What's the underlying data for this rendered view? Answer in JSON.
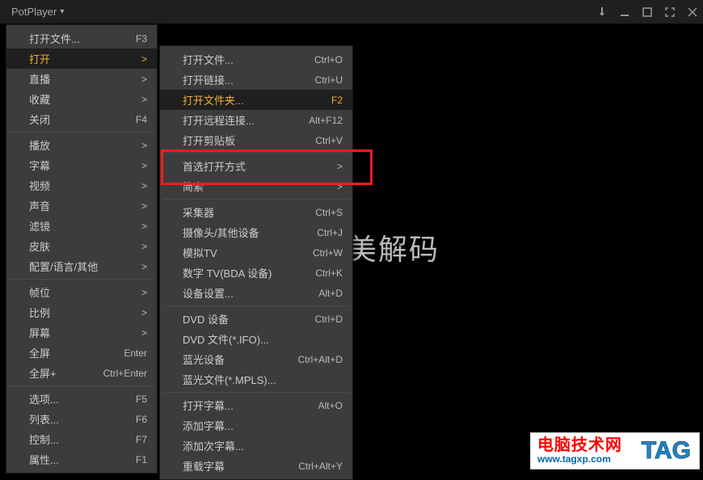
{
  "title": "PotPlayer",
  "watermark": "美解码",
  "menu1": [
    {
      "type": "item",
      "label": "打开文件...",
      "shortcut": "F3"
    },
    {
      "type": "item",
      "label": "打开",
      "shortcut": ">",
      "hl": true
    },
    {
      "type": "item",
      "label": "直播",
      "shortcut": ">"
    },
    {
      "type": "item",
      "label": "收藏",
      "shortcut": ">"
    },
    {
      "type": "item",
      "label": "关闭",
      "shortcut": "F4"
    },
    {
      "type": "sep"
    },
    {
      "type": "item",
      "label": "播放",
      "shortcut": ">"
    },
    {
      "type": "item",
      "label": "字幕",
      "shortcut": ">"
    },
    {
      "type": "item",
      "label": "视频",
      "shortcut": ">"
    },
    {
      "type": "item",
      "label": "声音",
      "shortcut": ">"
    },
    {
      "type": "item",
      "label": "滤镜",
      "shortcut": ">"
    },
    {
      "type": "item",
      "label": "皮肤",
      "shortcut": ">"
    },
    {
      "type": "item",
      "label": "配置/语言/其他",
      "shortcut": ">"
    },
    {
      "type": "sep"
    },
    {
      "type": "item",
      "label": "帧位",
      "shortcut": ">"
    },
    {
      "type": "item",
      "label": "比例",
      "shortcut": ">"
    },
    {
      "type": "item",
      "label": "屏幕",
      "shortcut": ">"
    },
    {
      "type": "item",
      "label": "全屏",
      "shortcut": "Enter"
    },
    {
      "type": "item",
      "label": "全屏+",
      "shortcut": "Ctrl+Enter"
    },
    {
      "type": "sep"
    },
    {
      "type": "item",
      "label": "选项...",
      "shortcut": "F5"
    },
    {
      "type": "item",
      "label": "列表...",
      "shortcut": "F6"
    },
    {
      "type": "item",
      "label": "控制...",
      "shortcut": "F7"
    },
    {
      "type": "item",
      "label": "属性...",
      "shortcut": "F1"
    }
  ],
  "menu2": [
    {
      "type": "item",
      "label": "打开文件...",
      "shortcut": "Ctrl+O"
    },
    {
      "type": "item",
      "label": "打开链接...",
      "shortcut": "Ctrl+U"
    },
    {
      "type": "item",
      "label": "打开文件夹...",
      "shortcut": "F2",
      "hl": true
    },
    {
      "type": "item",
      "label": "打开远程连接...",
      "shortcut": "Alt+F12"
    },
    {
      "type": "item",
      "label": "打开剪贴板",
      "shortcut": "Ctrl+V"
    },
    {
      "type": "sep"
    },
    {
      "type": "item",
      "label": "首选打开方式",
      "shortcut": ">"
    },
    {
      "type": "item",
      "label": "简索",
      "shortcut": ">"
    },
    {
      "type": "sep"
    },
    {
      "type": "item",
      "label": "采集器",
      "shortcut": "Ctrl+S"
    },
    {
      "type": "item",
      "label": "摄像头/其他设备",
      "shortcut": "Ctrl+J"
    },
    {
      "type": "item",
      "label": "模拟TV",
      "shortcut": "Ctrl+W"
    },
    {
      "type": "item",
      "label": "数字 TV(BDA 设备)",
      "shortcut": "Ctrl+K"
    },
    {
      "type": "item",
      "label": "设备设置...",
      "shortcut": "Alt+D"
    },
    {
      "type": "sep"
    },
    {
      "type": "item",
      "label": "DVD 设备",
      "shortcut": "Ctrl+D"
    },
    {
      "type": "item",
      "label": "DVD 文件(*.IFO)..."
    },
    {
      "type": "item",
      "label": "蓝光设备",
      "shortcut": "Ctrl+Alt+D"
    },
    {
      "type": "item",
      "label": "蓝光文件(*.MPLS)..."
    },
    {
      "type": "sep"
    },
    {
      "type": "item",
      "label": "打开字幕...",
      "shortcut": "Alt+O"
    },
    {
      "type": "item",
      "label": "添加字幕..."
    },
    {
      "type": "item",
      "label": "添加次字幕..."
    },
    {
      "type": "item",
      "label": "重载字幕",
      "shortcut": "Ctrl+Alt+Y"
    }
  ],
  "tag": {
    "cn": "电脑技术网",
    "url": "www.tagxp.com",
    "label": "TAG"
  }
}
